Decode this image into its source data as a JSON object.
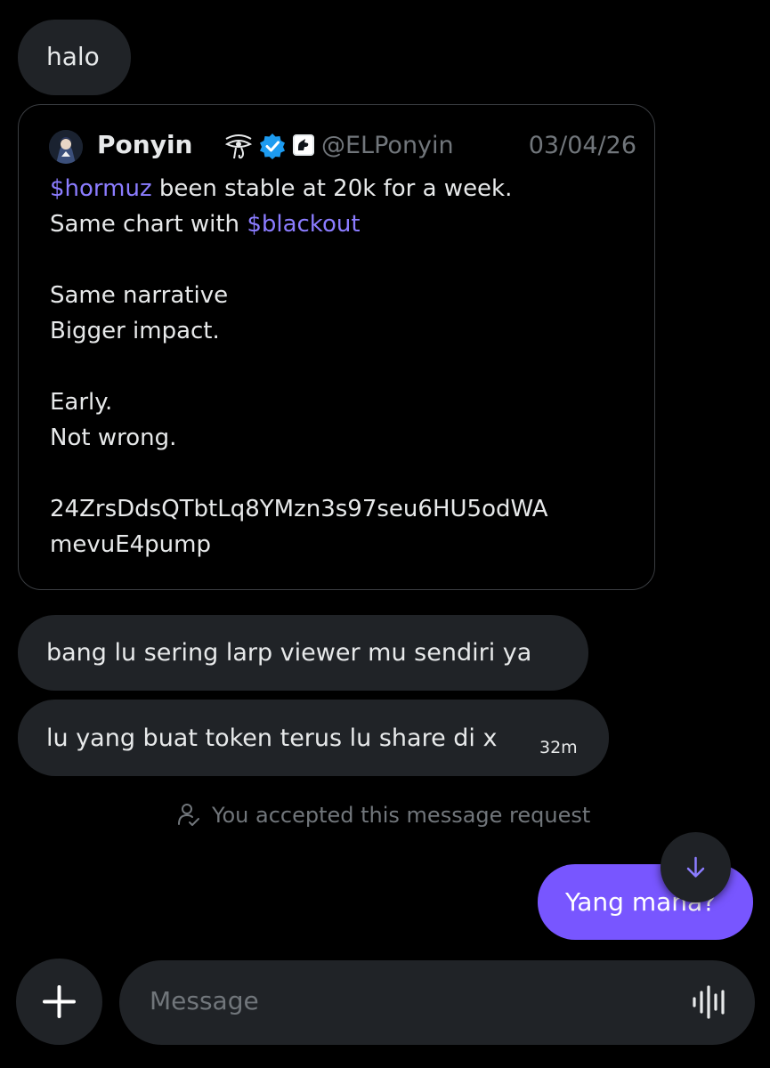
{
  "messages": {
    "halo": "halo",
    "msg1": "bang lu sering larp viewer mu sendiri ya",
    "msg2": "lu yang buat token terus lu share di x",
    "msg2_time": "32m",
    "outgoing": "Yang mana?"
  },
  "quote": {
    "name": "Ponyin",
    "handle": "@ELPonyin",
    "date": "03/04/26",
    "line1_tag": "$hormuz",
    "line1_text": " been stable at 20k for a week.",
    "line2_text": "Same chart with ",
    "line2_tag": "$blackout",
    "line3": "Same narrative",
    "line4": "Bigger impact.",
    "line5": "Early.",
    "line6": "Not wrong.",
    "line7": "24ZrsDdsQTbtLq8YMzn3s97seu6HU5odWA",
    "line8": "mevuE4pump"
  },
  "system": {
    "accepted_text": "You accepted this message request"
  },
  "composer": {
    "placeholder": "Message",
    "value": ""
  },
  "icons": {
    "scroll": "arrow-down-icon",
    "add": "plus-icon",
    "voice": "voice-wave-icon",
    "verified": "verified-badge-icon",
    "person": "person-check-icon"
  },
  "colors": {
    "background": "#000000",
    "incoming_bubble": "#202327",
    "outgoing_bubble": "#7856ff",
    "cashtag": "#8b7cff",
    "secondary_text": "#71767b",
    "verified": "#1d9bf0"
  }
}
